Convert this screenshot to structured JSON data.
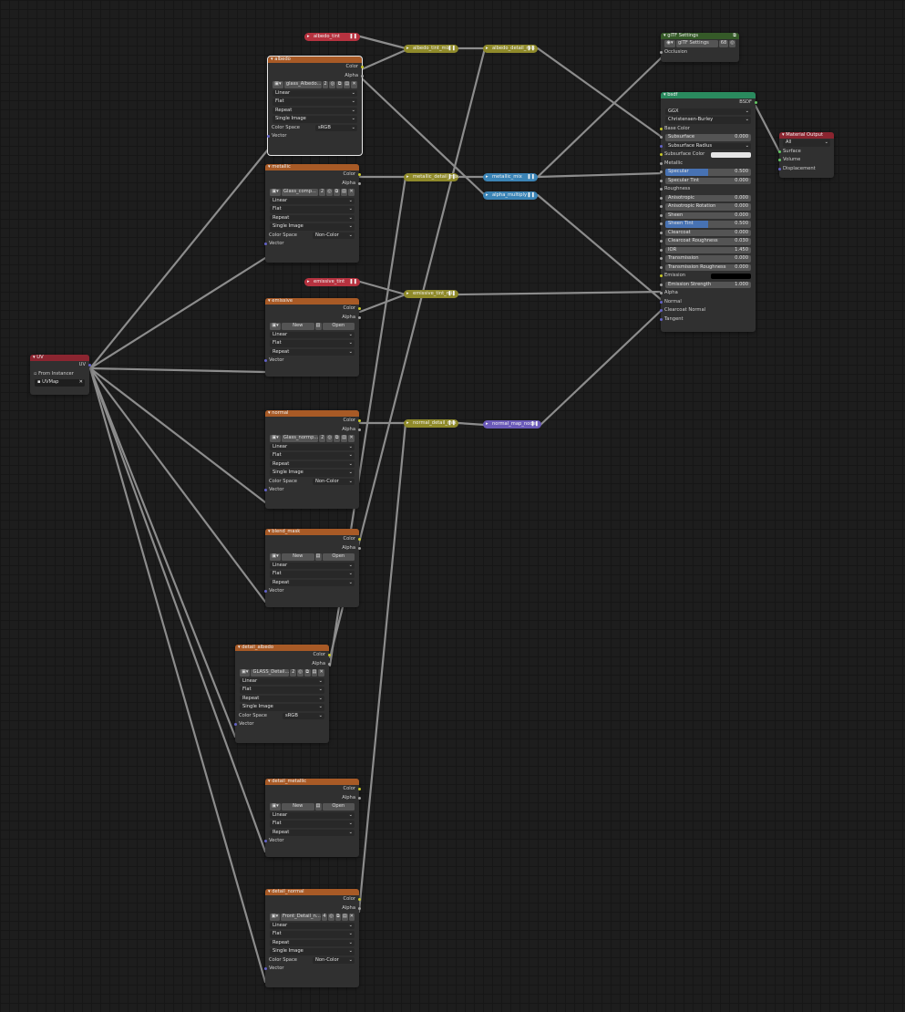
{
  "uv_node": {
    "title": "UV",
    "out_label": "UV",
    "from_instancer": "From Instancer",
    "map_value": "UVMap"
  },
  "pills": {
    "albedo_tint": "albedo_tint",
    "albedo_tint_mix": "albedo_tint_mix",
    "albedo_detail_mix": "albedo_detail_mix",
    "metallic_detail_mix": "metallic_detail_mix",
    "metallic_mix": "metallic_mix",
    "alpha_multiply": "alpha_multiply",
    "emissive_tint": "emissive_tint",
    "emissive_tint_mix": "emissive_tint_mix",
    "normal_detail_mix": "normal_detail_mix",
    "normal_map_node": "normal_map_node"
  },
  "labels": {
    "color": "Color",
    "alpha": "Alpha",
    "vector": "Vector",
    "linear": "Linear",
    "flat": "Flat",
    "repeat": "Repeat",
    "single_image": "Single Image",
    "color_space": "Color Space",
    "new": "New",
    "open": "Open"
  },
  "tex_nodes": {
    "albedo": {
      "title": "albedo",
      "image": "glass_Albedo...",
      "users": "2",
      "colorspace": "sRGB"
    },
    "metallic": {
      "title": "metallic",
      "image": "Glass_comp...",
      "users": "2",
      "colorspace": "Non-Color"
    },
    "emissive": {
      "title": "emissive"
    },
    "normal": {
      "title": "normal",
      "image": "Glass_normp...",
      "users": "2",
      "colorspace": "Non-Color"
    },
    "blend_mask": {
      "title": "blend_mask"
    },
    "detail_albedo": {
      "title": "detail_albedo",
      "image": "GLASS_Detail...",
      "users": "2",
      "colorspace": "sRGB"
    },
    "detail_metallic": {
      "title": "detail_metallic"
    },
    "detail_normal": {
      "title": "detail_normal",
      "image": "Front_Detail_n...",
      "users": "4",
      "colorspace": "Non-Color"
    }
  },
  "gltf": {
    "title": "glTF Settings",
    "name": "glTF Settings",
    "users": "68",
    "input": "Occlusion"
  },
  "bsdf": {
    "title": "bsdf",
    "out": "BSDF",
    "distribution": "GGX",
    "subsurface_method": "Christensen-Burley",
    "base_color": "Base Color",
    "subsurface": {
      "label": "Subsurface",
      "value": "0.000"
    },
    "subsurface_radius": "Subsurface Radius",
    "subsurface_color": "Subsurface Color",
    "metallic": "Metallic",
    "specular": {
      "label": "Specular",
      "value": "0.500",
      "fraction": 0.5
    },
    "specular_tint": {
      "label": "Specular Tint",
      "value": "0.000"
    },
    "roughness": "Roughness",
    "anisotropic": {
      "label": "Anisotropic",
      "value": "0.000"
    },
    "anisotropic_rotation": {
      "label": "Anisotropic Rotation",
      "value": "0.000"
    },
    "sheen": {
      "label": "Sheen",
      "value": "0.000"
    },
    "sheen_tint": {
      "label": "Sheen Tint",
      "value": "0.500",
      "fraction": 0.5
    },
    "clearcoat": {
      "label": "Clearcoat",
      "value": "0.000"
    },
    "clearcoat_roughness": {
      "label": "Clearcoat Roughness",
      "value": "0.030"
    },
    "ior": {
      "label": "IOR",
      "value": "1.450"
    },
    "transmission": {
      "label": "Transmission",
      "value": "0.000"
    },
    "transmission_roughness": {
      "label": "Transmission Roughness",
      "value": "0.000"
    },
    "emission": "Emission",
    "emission_strength": {
      "label": "Emission Strength",
      "value": "1.000"
    },
    "alpha": "Alpha",
    "normal": "Normal",
    "clearcoat_normal": "Clearcoat Normal",
    "tangent": "Tangent"
  },
  "material_output": {
    "title": "Material Output",
    "target": "All",
    "surface": "Surface",
    "volume": "Volume",
    "displacement": "Displacement"
  },
  "colors": {
    "background": "#1d1d1d",
    "texture_header": "#a85a26",
    "input_header": "#8b2530",
    "shader_header": "#2a8a5e",
    "group_header": "#355a28",
    "color_socket": "#c7c729",
    "float_socket": "#a1a1a1",
    "vector_socket": "#6363c7",
    "shader_socket": "#63c763",
    "wire": "#8c8c8c"
  }
}
